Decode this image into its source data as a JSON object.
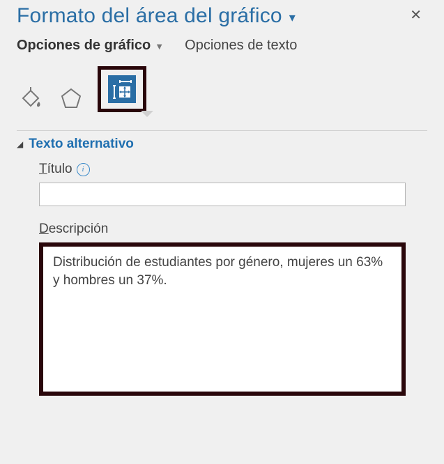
{
  "header": {
    "title": "Formato del área del gráfico"
  },
  "subtabs": {
    "chart_options": "Opciones de gráfico",
    "text_options": "Opciones de texto"
  },
  "section": {
    "alt_text_title": "Texto alternativo",
    "title_label": "Título",
    "description_label": "Descripción"
  },
  "fields": {
    "title_value": "",
    "description_value": "Distribución de estudiantes por género, mujeres un 63% y hombres un 37%."
  }
}
